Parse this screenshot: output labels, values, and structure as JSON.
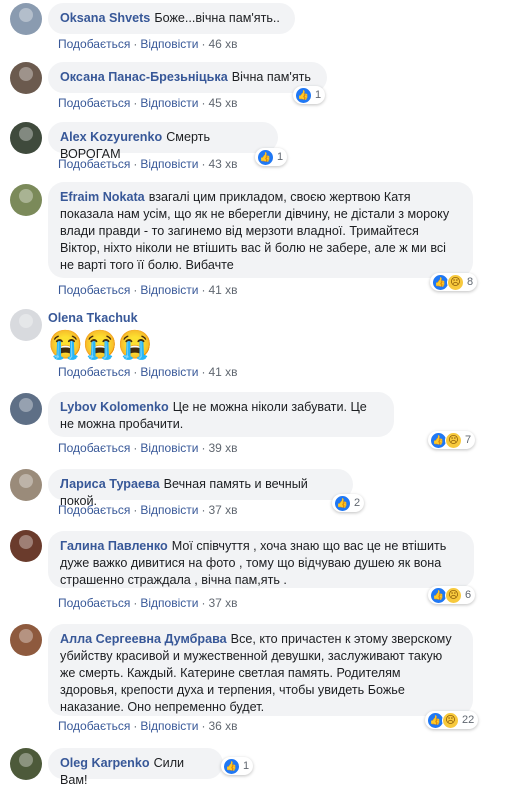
{
  "actions": {
    "like": "Подобається",
    "reply": "Відповісти",
    "sep": "·"
  },
  "comments": [
    {
      "author": "Oksana Shvets",
      "text": "Боже...вічна пам'ять..",
      "time": "46 хв"
    },
    {
      "author": "Оксана Панас-Брезьніцька",
      "text": "Вічна пам'ять",
      "time": "45 хв",
      "reactions": {
        "count": "1",
        "icons": [
          "like-icon"
        ]
      }
    },
    {
      "author": "Alex Kozyurenko",
      "text": "Смерть ВОРОГАМ",
      "time": "43 хв",
      "reactions": {
        "count": "1",
        "icons": [
          "like-icon"
        ]
      }
    },
    {
      "author": "Efraim Nokata",
      "text": "взагалі цим прикладом, своєю жертвою Катя показала нам усім, що як не вберегли дівчину, не дістали з мороку влади правди - то загинемо від мерзоти владної. Тримайтеся Віктор, ніхто ніколи не втішить вас й болю не забере, але ж ми всі не варті того її болю. Вибачте",
      "time": "41 хв",
      "reactions": {
        "count": "8",
        "icons": [
          "like-icon",
          "sad-icon"
        ]
      }
    },
    {
      "author": "Olena Tkachuk",
      "emoji": "😭😭😭",
      "time": "41 хв"
    },
    {
      "author": "Lybov Kolomenko",
      "text": "Це не можна ніколи забувати. Це не можна пробачити.",
      "time": "39 хв",
      "reactions": {
        "count": "7",
        "icons": [
          "like-icon",
          "sad-icon"
        ]
      }
    },
    {
      "author": "Лариса Тураева",
      "text": "Вечная память и вечный покой.",
      "time": "37 хв",
      "reactions": {
        "count": "2",
        "icons": [
          "like-icon"
        ]
      }
    },
    {
      "author": "Галина Павленко",
      "text": "Мої співчуття , хоча знаю що вас це не втішить дуже важко дивитися на фото , тому що відчуваю душею як вона страшенно страждала , вічна пам,ять .",
      "time": "37 хв",
      "reactions": {
        "count": "6",
        "icons": [
          "like-icon",
          "sad-icon"
        ]
      }
    },
    {
      "author": "Алла Сергеевна Думбрава",
      "text": "Все, кто причастен к этому зверскому убийству красивой и мужественной девушки, заслуживают такую же смерть. Каждый. Катерине светлая память. Родителям здоровья, крепости духа и терпения, чтобы увидеть Божье наказание. Оно непременно будет.",
      "time": "36 хв",
      "reactions": {
        "count": "22",
        "icons": [
          "like-icon",
          "sad-icon"
        ]
      }
    },
    {
      "author": "Oleg Karpenko",
      "text": "Сили Вам!",
      "reactions": {
        "count": "1",
        "icons": [
          "like-icon"
        ]
      }
    }
  ]
}
